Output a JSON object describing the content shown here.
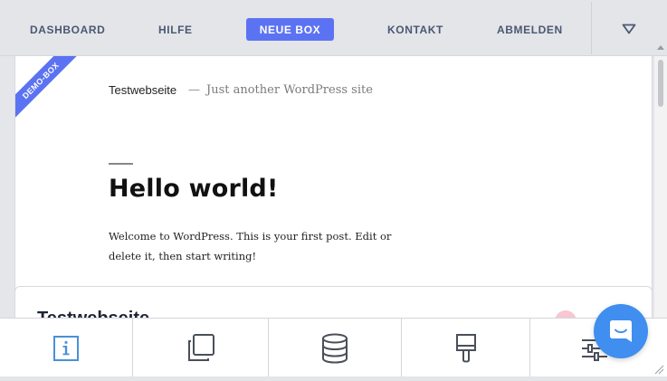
{
  "nav": {
    "items": [
      "DASHBOARD",
      "HILFE",
      "KONTAKT",
      "ABMELDEN"
    ],
    "primary_button": "NEUE BOX"
  },
  "preview": {
    "ribbon": "DEMO-BOX",
    "site_title": "Testwebseite",
    "site_separator": "—",
    "site_tagline": "Just another WordPress site",
    "post_title": "Hello world!",
    "post_body": "Welcome to WordPress. This is your first post. Edit or delete it, then start writing!"
  },
  "card": {
    "title": "Testwebseite"
  },
  "toolbar": {
    "icons": [
      "info-icon",
      "copy-icon",
      "database-icon",
      "paint-brush-icon",
      "sliders-icon"
    ]
  },
  "colors": {
    "accent": "#5b73f2",
    "chat": "#3f8ef0",
    "nav_text": "#4a5872",
    "toolbar_icon": "#4a4f59",
    "info_icon": "#4a90d9"
  }
}
